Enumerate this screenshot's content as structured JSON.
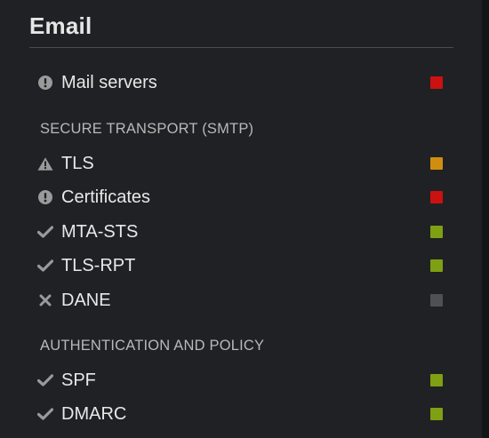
{
  "panel": {
    "title": "Email"
  },
  "top_items": [
    {
      "label": "Mail servers",
      "icon": "exclamation-circle-icon",
      "status": "fail",
      "color": "#cc1111"
    }
  ],
  "sections": [
    {
      "heading": "SECURE TRANSPORT (SMTP)",
      "items": [
        {
          "label": "TLS",
          "icon": "warning-triangle-icon",
          "status": "warning",
          "color": "#d08e10"
        },
        {
          "label": "Certificates",
          "icon": "exclamation-circle-icon",
          "status": "fail",
          "color": "#cc1111"
        },
        {
          "label": "MTA-STS",
          "icon": "check-icon",
          "status": "pass",
          "color": "#7fa012"
        },
        {
          "label": "TLS-RPT",
          "icon": "check-icon",
          "status": "pass",
          "color": "#7fa012"
        },
        {
          "label": "DANE",
          "icon": "x-icon",
          "status": "none",
          "color": "#4d5156"
        }
      ]
    },
    {
      "heading": "AUTHENTICATION AND POLICY",
      "items": [
        {
          "label": "SPF",
          "icon": "check-icon",
          "status": "pass",
          "color": "#7fa012"
        },
        {
          "label": "DMARC",
          "icon": "check-icon",
          "status": "pass",
          "color": "#7fa012"
        }
      ]
    }
  ]
}
